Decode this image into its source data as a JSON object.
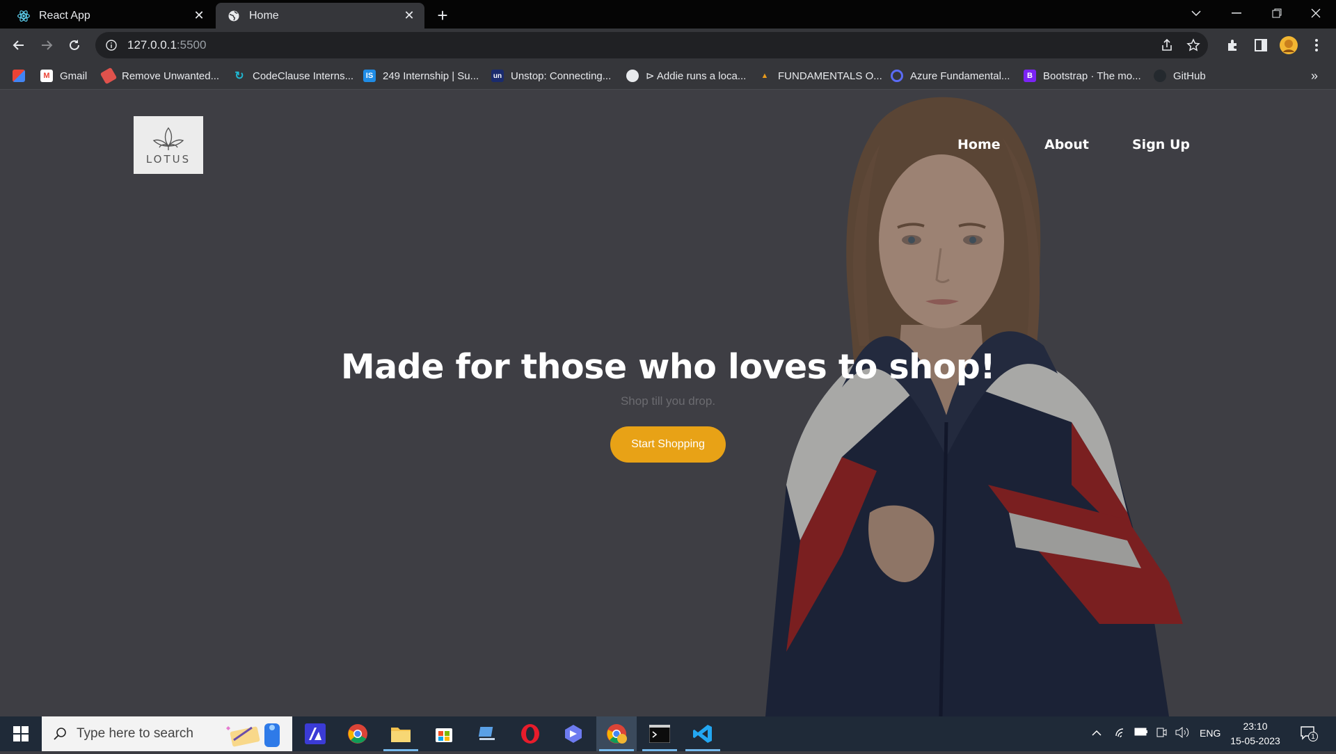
{
  "browser": {
    "tabs": [
      {
        "title": "React App",
        "icon": "react-icon"
      },
      {
        "title": "Home",
        "icon": "globe-icon"
      }
    ],
    "url_host": "127.0.0.1",
    "url_port": ":5500",
    "bookmarks": [
      {
        "label": "",
        "icon": "apps-icon"
      },
      {
        "label": "Gmail",
        "icon": "gmail-icon"
      },
      {
        "label": "Remove Unwanted...",
        "icon": "eraser-icon"
      },
      {
        "label": "CodeClause Interns...",
        "icon": "codeclause-icon"
      },
      {
        "label": "249 Internship | Su...",
        "icon": "is-icon"
      },
      {
        "label": "Unstop: Connecting...",
        "icon": "unstop-icon"
      },
      {
        "label": "⊳ Addie runs a loca...",
        "icon": "github-icon"
      },
      {
        "label": "FUNDAMENTALS O...",
        "icon": "chart-icon"
      },
      {
        "label": "Azure Fundamental...",
        "icon": "azure-icon"
      },
      {
        "label": "Bootstrap · The mo...",
        "icon": "bootstrap-icon"
      },
      {
        "label": "GitHub",
        "icon": "github-icon"
      }
    ],
    "bookmarks_overflow": "»"
  },
  "site": {
    "logo_text": "LOTUS",
    "nav": [
      "Home",
      "About",
      "Sign Up"
    ],
    "headline": "Made for those who loves to shop!",
    "tagline": "Shop till you drop.",
    "cta_label": "Start Shopping",
    "accent_color": "#e8a216"
  },
  "taskbar": {
    "search_placeholder": "Type here to search",
    "lang": "ENG",
    "time": "23:10",
    "date": "15-05-2023",
    "notifications": "1"
  }
}
